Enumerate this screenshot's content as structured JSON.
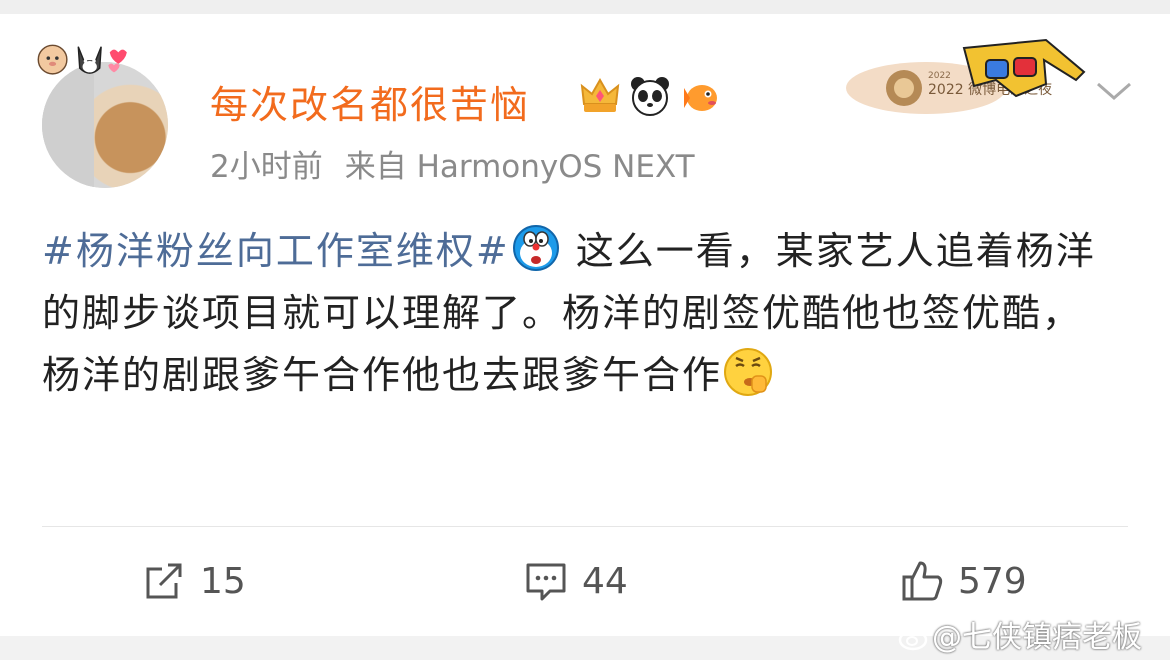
{
  "post": {
    "username": "每次改名都很苦恼",
    "time": "2小时前",
    "source": "来自 HarmonyOS NEXT",
    "festival_badge_text": "2022 微博电影之夜",
    "hashtag": "#杨洋粉丝向工作室维权#",
    "body_text": " 这么一看，某家艺人追着杨洋的脚步谈项目就可以理解了。杨洋的剧签优酷他也签优酷，杨洋的剧跟爹午合作他也去跟爹午合作",
    "badges": [
      "crown-icon",
      "panda-icon",
      "fish-icon"
    ],
    "inline_emojis": [
      "doraemon-emoji",
      "shush-face-emoji"
    ]
  },
  "actions": {
    "repost_count": "15",
    "comment_count": "44",
    "like_count": "579"
  },
  "watermark": "@七侠镇痞老板",
  "colors": {
    "username": "#f26b1d",
    "hashtag": "#4e6c97",
    "meta": "#8a8a8a",
    "body": "#222222"
  }
}
